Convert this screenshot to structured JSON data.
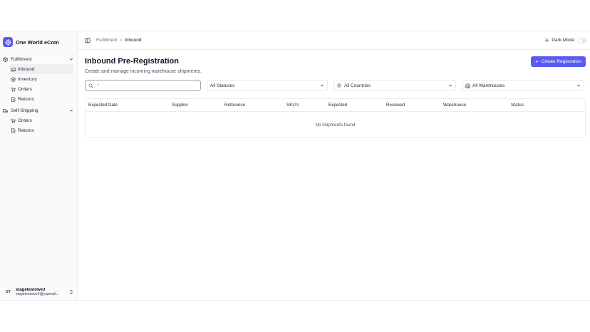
{
  "brand": {
    "name": "One World eCom",
    "accent": "#5b5bf0"
  },
  "sidebar": {
    "groups": [
      {
        "label": "Fulfillment",
        "icon": "package-icon",
        "items": [
          {
            "label": "Inbound",
            "icon": "inbox-icon",
            "active": true
          },
          {
            "label": "Inventory",
            "icon": "box-icon"
          },
          {
            "label": "Orders",
            "icon": "cart-icon"
          },
          {
            "label": "Returns",
            "icon": "document-icon"
          }
        ]
      },
      {
        "label": "Self-Shipping",
        "icon": "truck-icon",
        "items": [
          {
            "label": "Orders",
            "icon": "cart-icon"
          },
          {
            "label": "Returns",
            "icon": "document-icon"
          }
        ]
      }
    ]
  },
  "user": {
    "initials": "ST",
    "name": "stagetestowe3",
    "email": "stagetestowe3@yopmail..."
  },
  "breadcrumb": {
    "parent": "Fulfillment",
    "current": "Inbound"
  },
  "topbar": {
    "dark_mode_label": "Dark Mode"
  },
  "page": {
    "title": "Inbound Pre-Registration",
    "subtitle": "Create and manage incoming warehouse shipments.",
    "create_label": "Create Registration"
  },
  "filters": {
    "search_value": "*",
    "status": "All Statuses",
    "country": "All Countries",
    "warehouse": "All Warehouses"
  },
  "table": {
    "columns": [
      "Expected Date",
      "Supplier",
      "Reference",
      "SKU's",
      "Expected",
      "Recieved",
      "Warehouse",
      "Status"
    ],
    "empty_text": "No shipments found"
  }
}
